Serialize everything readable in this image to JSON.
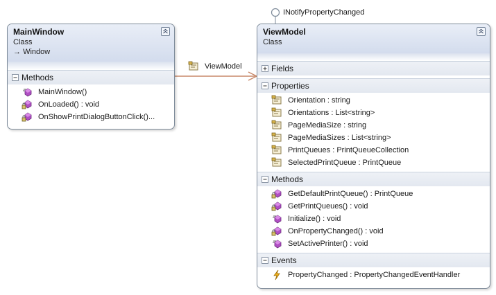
{
  "main_window": {
    "title": "MainWindow",
    "kind": "Class",
    "base": "Window",
    "sections": {
      "methods": {
        "label": "Methods",
        "items": [
          {
            "icon": "method-icon",
            "text": "MainWindow()"
          },
          {
            "icon": "private-method-icon",
            "text": "OnLoaded() : void"
          },
          {
            "icon": "private-method-icon",
            "text": "OnShowPrintDialogButtonClick()..."
          }
        ]
      }
    }
  },
  "association": {
    "label": "ViewModel",
    "icon": "property-icon",
    "color": "#c8896a"
  },
  "interface_lollipop": {
    "label": "INotifyPropertyChanged"
  },
  "view_model": {
    "title": "ViewModel",
    "kind": "Class",
    "sections": {
      "fields": {
        "label": "Fields"
      },
      "properties": {
        "label": "Properties",
        "items": [
          {
            "icon": "property-icon",
            "text": "Orientation : string"
          },
          {
            "icon": "property-icon",
            "text": "Orientations : List<string>"
          },
          {
            "icon": "property-icon",
            "text": "PageMediaSize : string"
          },
          {
            "icon": "property-icon",
            "text": "PageMediaSizes : List<string>"
          },
          {
            "icon": "property-icon",
            "text": "PrintQueues : PrintQueueCollection"
          },
          {
            "icon": "property-icon",
            "text": "SelectedPrintQueue : PrintQueue"
          }
        ]
      },
      "methods": {
        "label": "Methods",
        "items": [
          {
            "icon": "private-method-icon",
            "text": "GetDefaultPrintQueue() : PrintQueue"
          },
          {
            "icon": "private-method-icon",
            "text": "GetPrintQueues() : void"
          },
          {
            "icon": "method-icon",
            "text": "Initialize() : void"
          },
          {
            "icon": "private-method-icon",
            "text": "OnPropertyChanged() : void"
          },
          {
            "icon": "method-icon",
            "text": "SetActivePrinter() : void"
          }
        ]
      },
      "events": {
        "label": "Events",
        "items": [
          {
            "icon": "event-icon",
            "text": "PropertyChanged : PropertyChangedEventHandler"
          }
        ]
      }
    }
  }
}
